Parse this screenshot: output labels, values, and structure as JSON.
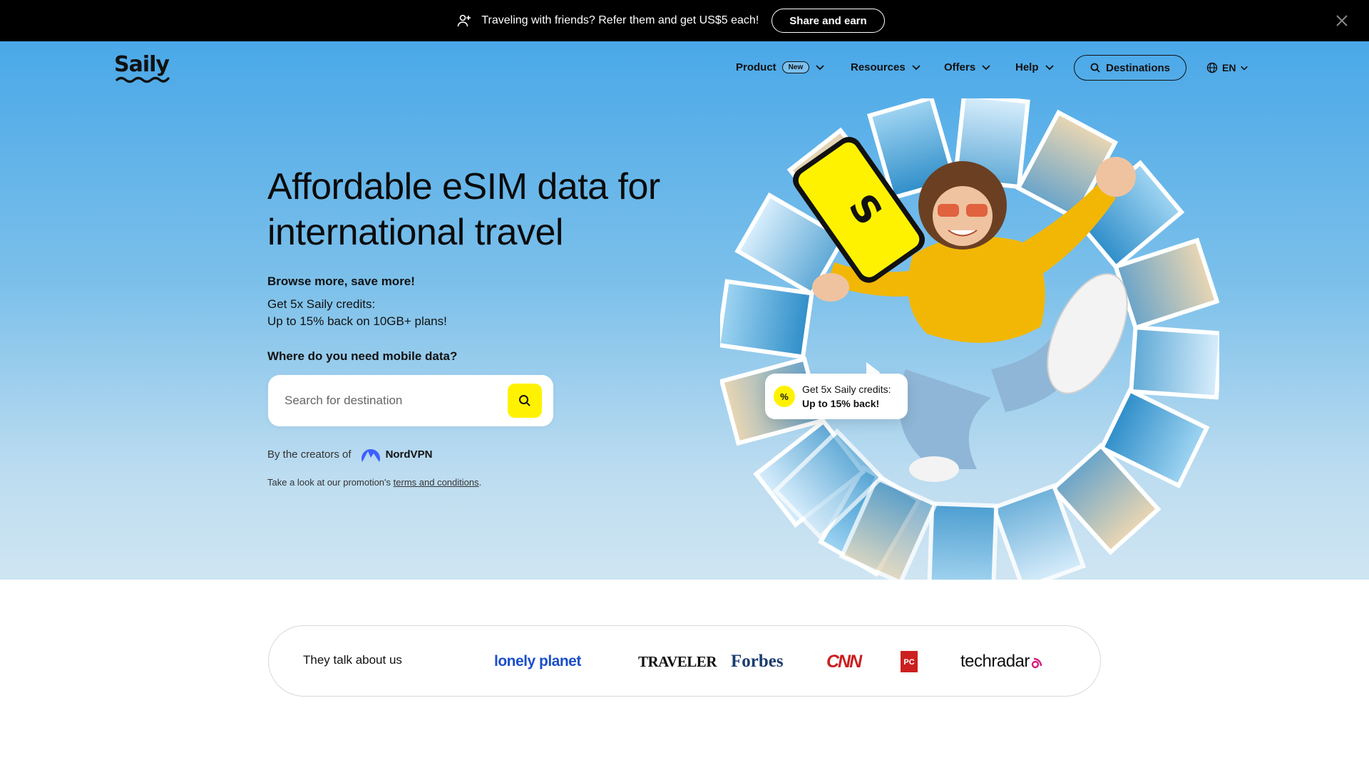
{
  "promo": {
    "text": "Traveling with friends? Refer them and get US$5 each!",
    "button": "Share and earn",
    "icon": "add-user-icon",
    "close_icon": "close-icon"
  },
  "nav": {
    "logo": "Saily",
    "product": "Product",
    "product_badge": "New",
    "resources": "Resources",
    "offers": "Offers",
    "help": "Help",
    "destinations": "Destinations",
    "language": "EN"
  },
  "hero": {
    "headline": "Affordable eSIM data for international travel",
    "sub_strong": "Browse more, save more!",
    "sub_line1": "Get 5x Saily credits:",
    "sub_line2": "Up to 15% back on 10GB+ plans!",
    "where": "Where do you need mobile data?",
    "search_placeholder": "Search for destination",
    "creators": "By the creators of",
    "nordvpn": "NordVPN",
    "terms_prefix": "Take a look at our promotion's",
    "terms_link": "terms and conditions",
    "terms_suffix": "."
  },
  "credit_card": {
    "line1": "Get 5x Saily credits:",
    "line2": "Up to 15% back!",
    "icon_glyph": "%"
  },
  "press": {
    "label": "They talk about us",
    "logos": [
      "lonely planet",
      "TRAVELER",
      "Forbes",
      "CNN",
      "PC",
      "techradar"
    ]
  },
  "colors": {
    "accent_yellow": "#fff200",
    "hero_top": "#4aa8e8",
    "hero_bottom": "#cfe5f2",
    "promo_bg": "#000000"
  }
}
